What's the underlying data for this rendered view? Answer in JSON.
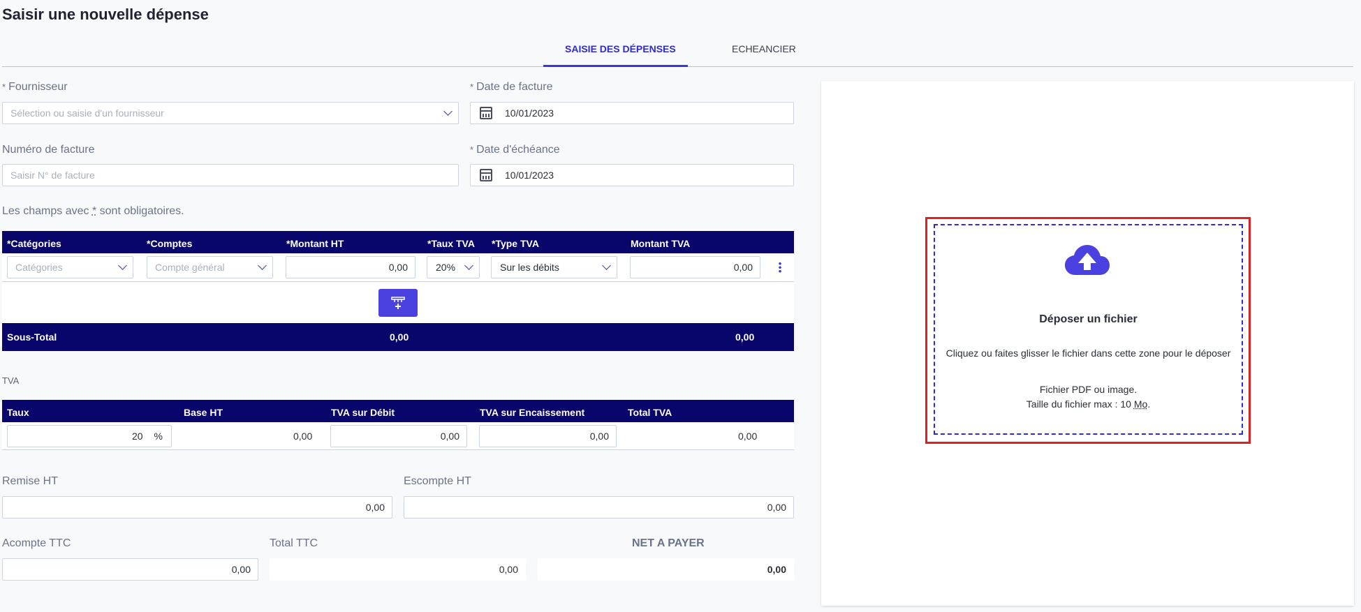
{
  "page": {
    "title": "Saisir une nouvelle dépense"
  },
  "tabs": [
    {
      "label": "SAISIE DES DÉPENSES",
      "active": true
    },
    {
      "label": "ECHEANCIER",
      "active": false
    }
  ],
  "form": {
    "supplier": {
      "label": "Fournisseur",
      "placeholder": "Sélection ou saisie d'un fournisseur"
    },
    "invoice_date": {
      "label": "Date de facture",
      "value": "10/01/2023"
    },
    "invoice_number": {
      "label": "Numéro de facture",
      "placeholder": "Saisir N° de facture"
    },
    "due_date": {
      "label": "Date d'échéance",
      "value": "10/01/2023"
    },
    "required_note_prefix": "Les champs avec",
    "required_note_star": "*",
    "required_note_suffix": "sont obligatoires.",
    "required_marker": "*"
  },
  "lines_table": {
    "headers": [
      "Catégories",
      "Comptes",
      "Montant HT",
      "Taux TVA",
      "Type TVA",
      "Montant TVA"
    ],
    "row": {
      "category_placeholder": "Catégories",
      "account_placeholder": "Compte général",
      "amount_ht": "0,00",
      "vat_rate": "20%",
      "vat_type": "Sur les débits",
      "vat_amount": "0,00"
    },
    "subtotal": {
      "label": "Sous-Total",
      "ht": "0,00",
      "tva": "0,00"
    }
  },
  "vat_table": {
    "title": "TVA",
    "headers": [
      "Taux",
      "Base HT",
      "TVA sur Débit",
      "TVA sur Encaissement",
      "Total TVA"
    ],
    "row": {
      "rate": "20",
      "unit": "%",
      "base_ht": "0,00",
      "tva_debit": "0,00",
      "tva_encaissement": "0,00",
      "total_tva": "0,00"
    }
  },
  "totals": {
    "remise": {
      "label": "Remise HT",
      "value": "0,00"
    },
    "escompte": {
      "label": "Escompte HT",
      "value": "0,00"
    },
    "acompte": {
      "label": "Acompte TTC",
      "value": "0,00"
    },
    "total_ttc": {
      "label": "Total TTC",
      "value": "0,00"
    },
    "net": {
      "label": "NET A PAYER",
      "value": "0,00"
    }
  },
  "upload": {
    "title": "Déposer un fichier",
    "hint": "Cliquez ou faites glisser le fichier dans cette zone pour le déposer",
    "formats": "Fichier PDF ou image.",
    "max_size_prefix": "Taille du fichier max : 10",
    "max_size_unit": "Mo",
    "max_size_suffix": "."
  },
  "colors": {
    "accent": "#3b36d4",
    "header_bg": "#08056b",
    "highlight": "#e02020"
  }
}
